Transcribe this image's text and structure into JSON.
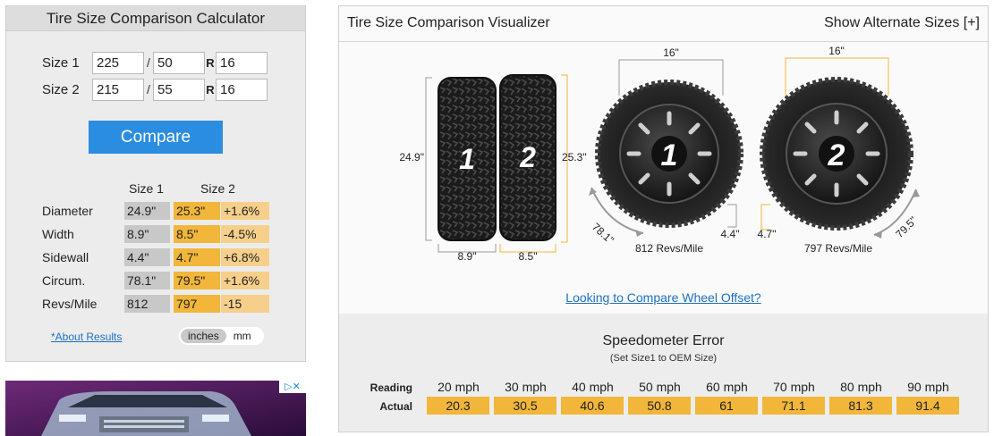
{
  "calculator": {
    "title": "Tire Size Comparison Calculator",
    "size1": {
      "label": "Size 1",
      "width": "225",
      "aspect": "50",
      "rim": "16"
    },
    "size2": {
      "label": "Size 2",
      "width": "215",
      "aspect": "55",
      "rim": "16"
    },
    "slash": "/",
    "r": "R",
    "compare_label": "Compare",
    "results": {
      "col1": "Size 1",
      "col2": "Size 2",
      "rows": [
        {
          "label": "Diameter",
          "v1": "24.9\"",
          "v2": "25.3\"",
          "diff": "+1.6%"
        },
        {
          "label": "Width",
          "v1": "8.9\"",
          "v2": "8.5\"",
          "diff": "-4.5%"
        },
        {
          "label": "Sidewall",
          "v1": "4.4\"",
          "v2": "4.7\"",
          "diff": "+6.8%"
        },
        {
          "label": "Circum.",
          "v1": "78.1\"",
          "v2": "79.5\"",
          "diff": "+1.6%"
        },
        {
          "label": "Revs/Mile",
          "v1": "812",
          "v2": "797",
          "diff": "-15"
        }
      ]
    },
    "about_link": "*About Results",
    "units": {
      "inches": "inches",
      "mm": "mm",
      "selected": "inches"
    }
  },
  "ad": {
    "adchoices": "▷✕"
  },
  "visualizer": {
    "title": "Tire Size Comparison Visualizer",
    "alt_link": "Show Alternate Sizes [+]",
    "tire1_num": "1",
    "tire2_num": "2",
    "dim_diameter1": "24.9\"",
    "dim_diameter2": "25.3\"",
    "dim_width1": "8.9\"",
    "dim_width2": "8.5\"",
    "rim1": "16\"",
    "rim2": "16\"",
    "sidewall1": "4.4\"",
    "sidewall2": "4.7\"",
    "circ1": "78.1\"",
    "circ2": "79.5\"",
    "revs1": "812 Revs/Mile",
    "revs2": "797 Revs/Mile",
    "offset_link": "Looking to Compare Wheel Offset?",
    "colors": {
      "size1_line": "#999999",
      "size2_line": "#f1b63a"
    }
  },
  "speedometer": {
    "title": "Speedometer Error",
    "subtitle": "(Set Size1 to OEM Size)",
    "reading_label": "Reading",
    "actual_label": "Actual",
    "readings": [
      "20 mph",
      "30 mph",
      "40 mph",
      "50 mph",
      "60 mph",
      "70 mph",
      "80 mph",
      "90 mph"
    ],
    "actuals": [
      "20.3",
      "30.5",
      "40.6",
      "50.8",
      "61",
      "71.1",
      "81.3",
      "91.4"
    ]
  }
}
